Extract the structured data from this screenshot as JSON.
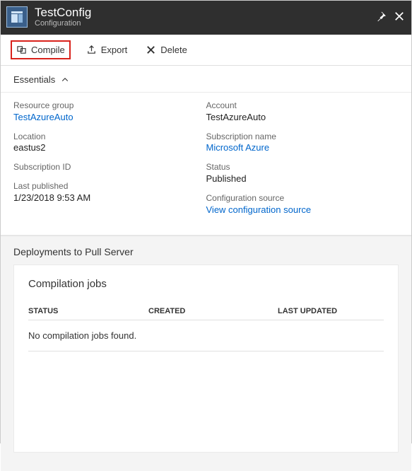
{
  "header": {
    "title": "TestConfig",
    "subtitle": "Configuration"
  },
  "toolbar": {
    "compile": "Compile",
    "export": "Export",
    "delete": "Delete"
  },
  "essentials": {
    "label": "Essentials",
    "left": {
      "resource_group_label": "Resource group",
      "resource_group_value": "TestAzureAuto",
      "location_label": "Location",
      "location_value": "eastus2",
      "subscription_id_label": "Subscription ID",
      "subscription_id_value": "",
      "last_published_label": "Last published",
      "last_published_value": "1/23/2018 9:53 AM"
    },
    "right": {
      "account_label": "Account",
      "account_value": "TestAzureAuto",
      "subscription_name_label": "Subscription name",
      "subscription_name_value": "Microsoft Azure",
      "status_label": "Status",
      "status_value": "Published",
      "config_source_label": "Configuration source",
      "config_source_value": "View configuration source"
    }
  },
  "deployments": {
    "title": "Deployments to Pull Server",
    "panel_title": "Compilation jobs",
    "columns": {
      "status": "STATUS",
      "created": "CREATED",
      "last_updated": "LAST UPDATED"
    },
    "empty_text": "No compilation jobs found."
  }
}
